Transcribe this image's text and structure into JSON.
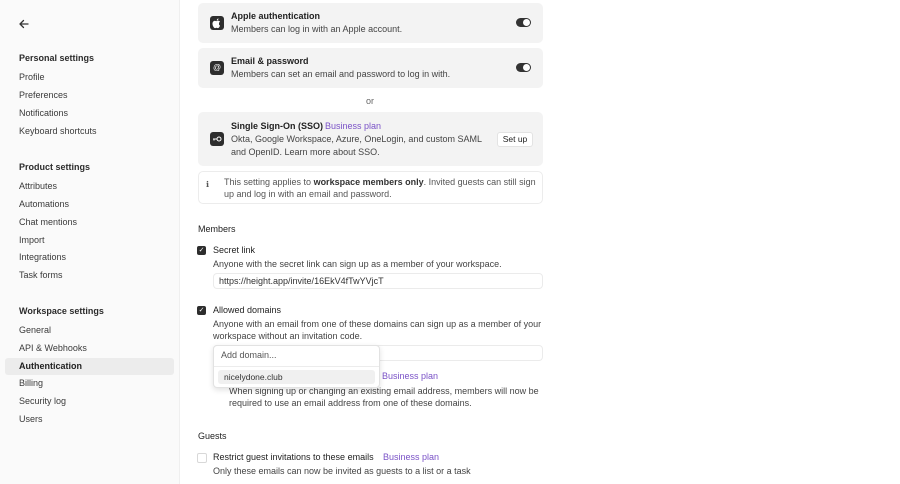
{
  "sidebar": {
    "personal_title": "Personal settings",
    "personal_items": [
      "Profile",
      "Preferences",
      "Notifications",
      "Keyboard shortcuts"
    ],
    "product_title": "Product settings",
    "product_items": [
      "Attributes",
      "Automations",
      "Chat mentions",
      "Import",
      "Integrations",
      "Task forms"
    ],
    "workspace_title": "Workspace settings",
    "workspace_items": [
      "General",
      "API & Webhooks",
      "Authentication",
      "Billing",
      "Security log",
      "Users"
    ]
  },
  "auth": {
    "apple_title": "Apple authentication",
    "apple_desc": "Members can log in with an Apple account.",
    "email_title": "Email & password",
    "email_desc": "Members can set an email and password to log in with.",
    "or": "or",
    "sso_title": "Single Sign-On (SSO)",
    "sso_badge": "Business plan",
    "sso_desc_1": "Okta, Google Workspace, Azure, OneLogin, and custom SAML",
    "sso_desc_2": "and OpenID. Learn more about SSO.",
    "setup": "Set up",
    "note_pre": "This setting applies to ",
    "note_bold": "workspace members only",
    "note_post": ". Invited guests can still sign",
    "note_line2": "up and log in with an email and password."
  },
  "members": {
    "title": "Members",
    "secret_title": "Secret link",
    "secret_desc": "Anyone with the secret link can sign up as a member of your workspace.",
    "secret_url": "https://height.app/invite/16EkV4fTwYVjcT",
    "domains_title": "Allowed domains",
    "domains_desc_1": "Anyone with an email from one of these domains can sign up as a member of your",
    "domains_desc_2": "workspace without an invitation code.",
    "add_domain_placeholder": "Add domain...",
    "domain_option": "nicelydone.club",
    "restrict_badge": "Business plan",
    "restrict_desc_1": "When signing up or changing an existing email address, members will now be",
    "restrict_desc_2": "required to use an email address from one of these domains."
  },
  "guests": {
    "title": "Guests",
    "restrict_title": "Restrict guest invitations to these emails",
    "restrict_badge": "Business plan",
    "restrict_desc": "Only these emails can now be invited as guests to a list or a task"
  },
  "icons": {
    "back": "arrow-left-icon",
    "apple": "apple-icon",
    "email": "at-icon",
    "sso": "key-icon",
    "info": "info-icon",
    "check": "check-icon"
  },
  "colors": {
    "accent": "#7a52c7",
    "toggle_on": "#333333",
    "active_item": "#ececec"
  }
}
